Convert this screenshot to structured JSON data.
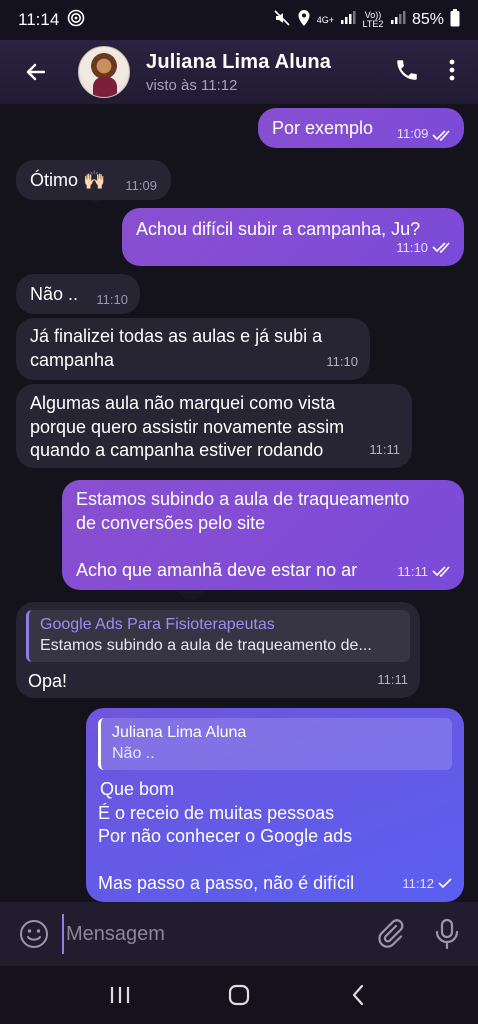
{
  "status_bar": {
    "time": "11:14",
    "network": "4G+",
    "lte_label": "Vo)) LTE2",
    "battery": "85%"
  },
  "header": {
    "contact_name": "Juliana Lima Aluna",
    "last_seen": "visto às 11:12"
  },
  "messages": [
    {
      "id": "m1",
      "direction": "out",
      "text": "Por exemplo",
      "time": "11:09",
      "status": "read"
    },
    {
      "id": "m2",
      "direction": "in",
      "text": "Ótimo 🙌🏻",
      "time": "11:09"
    },
    {
      "id": "m3",
      "direction": "out",
      "text": "Achou difícil subir a campanha, Ju?",
      "time": "11:10",
      "status": "read"
    },
    {
      "id": "m4",
      "direction": "in",
      "text": "Não ..",
      "time": "11:10"
    },
    {
      "id": "m5",
      "direction": "in",
      "text": "Já finalizei todas as aulas e já subi a\ncampanha",
      "time": "11:10"
    },
    {
      "id": "m6",
      "direction": "in",
      "text": "Algumas aula não marquei como vista\nporque quero assistir novamente assim\nquando a campanha estiver rodando",
      "time": "11:11"
    },
    {
      "id": "m7",
      "direction": "out",
      "text": "Estamos subindo a aula de traqueamento\nde conversões pelo site\n\nAcho que amanhã deve estar no ar",
      "time": "11:11",
      "status": "read"
    },
    {
      "id": "m8",
      "direction": "in",
      "reply_to": {
        "title": "Google Ads Para Fisioterapeutas",
        "text": "Estamos subindo a aula de traqueamento de..."
      },
      "text": "Opa!",
      "time": "11:11"
    },
    {
      "id": "m9",
      "direction": "out",
      "reply_to": {
        "title": "Juliana Lima Aluna",
        "text": "Não .."
      },
      "text": "Que bom\nÉ o receio de muitas pessoas\nPor não conhecer o Google ads\n\nMas passo a passo, não é difícil",
      "time": "11:12",
      "status": "sent"
    }
  ],
  "input": {
    "placeholder": "Mensagem"
  },
  "icons": {
    "back": "arrow-left-icon",
    "call": "phone-icon",
    "menu": "more-vertical-icon",
    "emoji": "smiley-icon",
    "attach": "paperclip-icon",
    "mic": "microphone-icon"
  },
  "colors": {
    "accent": "#8d7fe6",
    "outgoing_bubble": "#8a4fd0",
    "incoming_bubble": "#272433",
    "header_bg": "#2a2340"
  }
}
